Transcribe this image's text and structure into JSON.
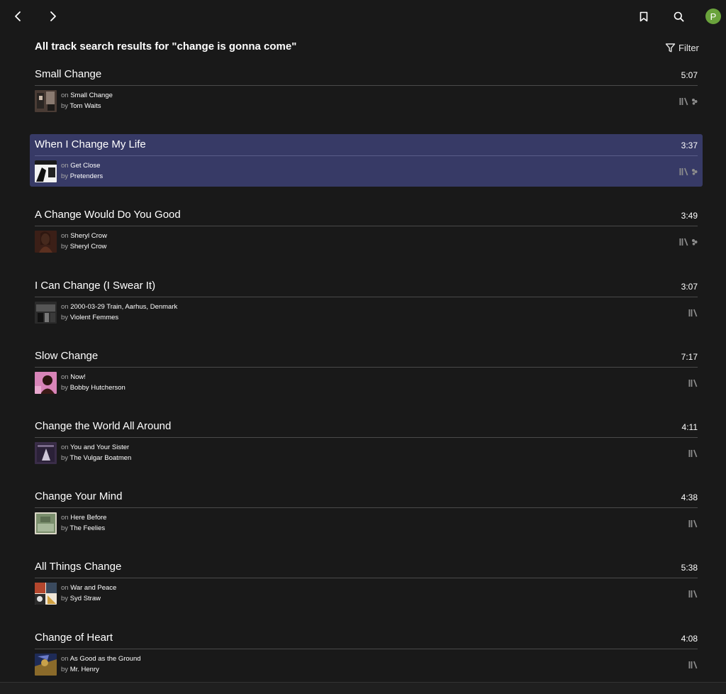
{
  "header": {
    "title": "All track search results for \"change is gonna come\"",
    "filter_label": "Filter"
  },
  "account": {
    "avatar_letter": "P",
    "avatar_color": "#6aa33c"
  },
  "labels": {
    "on": "on",
    "by": "by"
  },
  "colors": {
    "background": "#191919",
    "selected_row": "#373a66",
    "muted_text": "#a8a8a8"
  },
  "tracks": [
    {
      "title": "Small Change",
      "duration": "5:07",
      "album": "Small Change",
      "artist": "Tom Waits",
      "selected": false,
      "has_source_icon": true
    },
    {
      "title": "When I Change My Life",
      "duration": "3:37",
      "album": "Get Close",
      "artist": "Pretenders",
      "selected": true,
      "has_source_icon": true
    },
    {
      "title": "A Change Would Do You Good",
      "duration": "3:49",
      "album": "Sheryl Crow",
      "artist": "Sheryl Crow",
      "selected": false,
      "has_source_icon": true
    },
    {
      "title": "I Can Change (I Swear It)",
      "duration": "3:07",
      "album": "2000-03-29 Train, Aarhus, Denmark",
      "artist": "Violent Femmes",
      "selected": false,
      "has_source_icon": false
    },
    {
      "title": "Slow Change",
      "duration": "7:17",
      "album": "Now!",
      "artist": "Bobby Hutcherson",
      "selected": false,
      "has_source_icon": false
    },
    {
      "title": "Change the World All Around",
      "duration": "4:11",
      "album": "You and Your Sister",
      "artist": "The Vulgar Boatmen",
      "selected": false,
      "has_source_icon": false
    },
    {
      "title": "Change Your Mind",
      "duration": "4:38",
      "album": "Here Before",
      "artist": "The Feelies",
      "selected": false,
      "has_source_icon": false
    },
    {
      "title": "All Things Change",
      "duration": "5:38",
      "album": "War and Peace",
      "artist": "Syd Straw",
      "selected": false,
      "has_source_icon": false
    },
    {
      "title": "Change of Heart",
      "duration": "4:08",
      "album": "As Good as the Ground",
      "artist": "Mr. Henry",
      "selected": false,
      "has_source_icon": false
    }
  ]
}
